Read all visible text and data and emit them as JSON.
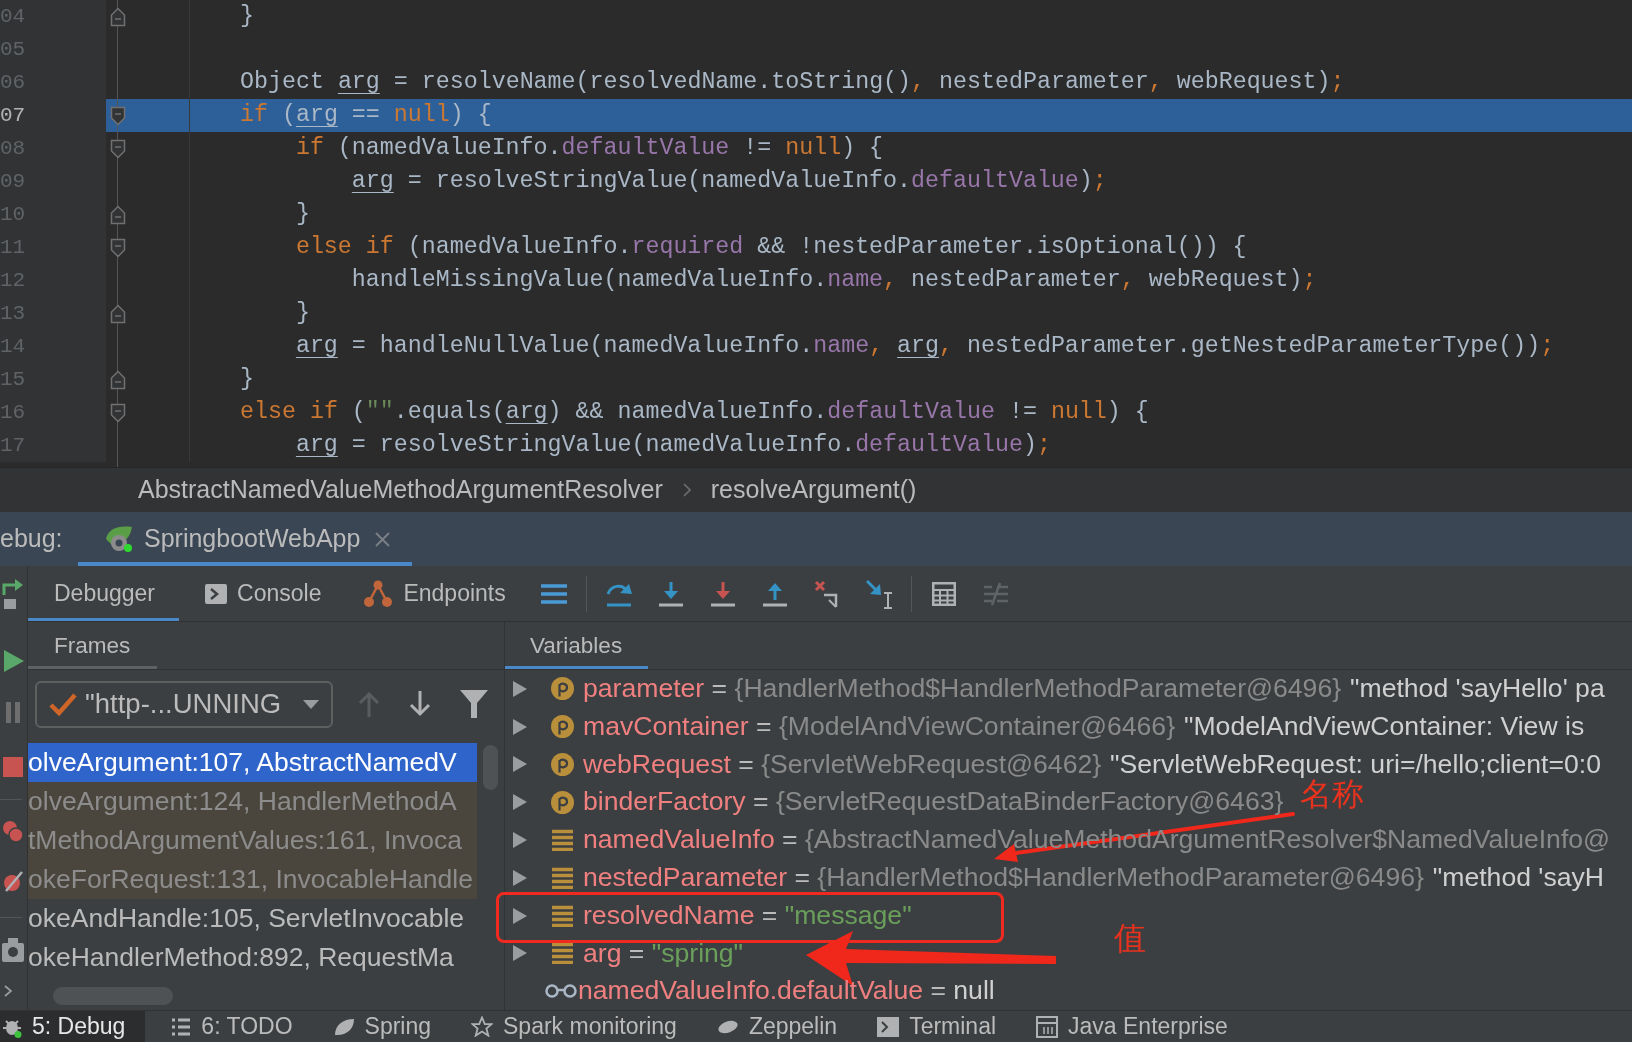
{
  "editor": {
    "lines": [
      {
        "number": "04",
        "current": false,
        "block_end": true,
        "tokens": [
          {
            "text": "}",
            "kind": "plain"
          }
        ]
      },
      {
        "number": "05",
        "current": false
      },
      {
        "number": "06",
        "current": false,
        "tokens": [
          {
            "text": "Object ",
            "kind": "plain"
          },
          {
            "text": "arg",
            "kind": "var"
          },
          {
            "text": " = resolveName(resolvedName.toString()",
            "kind": "plain"
          },
          {
            "text": ",",
            "kind": "punct"
          },
          {
            "text": " nestedParameter",
            "kind": "plain"
          },
          {
            "text": ",",
            "kind": "punct"
          },
          {
            "text": " webRequest)",
            "kind": "plain"
          },
          {
            "text": ";",
            "kind": "punct"
          }
        ]
      },
      {
        "number": "07",
        "current": true,
        "block_start": true,
        "tokens": [
          {
            "text": "if",
            "kind": "keyword"
          },
          {
            "text": " (",
            "kind": "plain"
          },
          {
            "text": "arg",
            "kind": "var"
          },
          {
            "text": " == ",
            "kind": "plain"
          },
          {
            "text": "null",
            "kind": "keyword"
          },
          {
            "text": ") {",
            "kind": "plain"
          }
        ],
        "children": [
          {
            "number": "08",
            "current": false,
            "block_start": true,
            "tokens": [
              {
                "text": "if",
                "kind": "keyword"
              },
              {
                "text": " (namedValueInfo.",
                "kind": "plain"
              },
              {
                "text": "defaultValue",
                "kind": "field"
              },
              {
                "text": " != ",
                "kind": "plain"
              },
              {
                "text": "null",
                "kind": "keyword"
              },
              {
                "text": ") {",
                "kind": "plain"
              }
            ],
            "children": [
              {
                "number": "09",
                "current": false,
                "tokens": [
                  {
                    "text": "arg",
                    "kind": "var"
                  },
                  {
                    "text": " = resolveStringValue(namedValueInfo.",
                    "kind": "plain"
                  },
                  {
                    "text": "defaultValue",
                    "kind": "field"
                  },
                  {
                    "text": ")",
                    "kind": "plain"
                  },
                  {
                    "text": ";",
                    "kind": "punct"
                  }
                ]
              }
            ]
          },
          {
            "number": "10",
            "current": false,
            "block_end": true,
            "tokens": [
              {
                "text": "}",
                "kind": "plain"
              }
            ]
          },
          {
            "number": "11",
            "current": false,
            "block_start": true,
            "tokens": [
              {
                "text": "else if",
                "kind": "keyword"
              },
              {
                "text": " (namedValueInfo.",
                "kind": "plain"
              },
              {
                "text": "required",
                "kind": "field"
              },
              {
                "text": " && !nestedParameter.isOptional()) {",
                "kind": "plain"
              }
            ],
            "children": [
              {
                "number": "12",
                "current": false,
                "tokens": [
                  {
                    "text": "handleMissingValue(namedValueInfo.",
                    "kind": "plain"
                  },
                  {
                    "text": "name",
                    "kind": "field"
                  },
                  {
                    "text": ",",
                    "kind": "punct"
                  },
                  {
                    "text": " nestedParameter",
                    "kind": "plain"
                  },
                  {
                    "text": ",",
                    "kind": "punct"
                  },
                  {
                    "text": " webRequest)",
                    "kind": "plain"
                  },
                  {
                    "text": ";",
                    "kind": "punct"
                  }
                ]
              }
            ]
          },
          {
            "number": "13",
            "current": false,
            "block_end": true,
            "tokens": [
              {
                "text": "}",
                "kind": "plain"
              }
            ]
          },
          {
            "number": "14",
            "current": false,
            "tokens": [
              {
                "text": "arg",
                "kind": "var"
              },
              {
                "text": " = handleNullValue(namedValueInfo.",
                "kind": "plain"
              },
              {
                "text": "name",
                "kind": "field"
              },
              {
                "text": ", ",
                "kind": "punct"
              },
              {
                "text": "arg",
                "kind": "var"
              },
              {
                "text": ",",
                "kind": "punct"
              },
              {
                "text": " nestedParameter.getNestedParameterType())",
                "kind": "plain"
              },
              {
                "text": ";",
                "kind": "punct"
              }
            ]
          }
        ]
      },
      {
        "number": "15",
        "current": false,
        "block_end": true,
        "tokens": [
          {
            "text": "}",
            "kind": "plain"
          }
        ]
      },
      {
        "number": "16",
        "current": false,
        "block_start": true,
        "tokens": [
          {
            "text": "else if",
            "kind": "keyword"
          },
          {
            "text": " (",
            "kind": "plain"
          },
          {
            "text": "\"\"",
            "kind": "string"
          },
          {
            "text": ".equals(",
            "kind": "plain"
          },
          {
            "text": "arg",
            "kind": "var"
          },
          {
            "text": ") && namedValueInfo.",
            "kind": "plain"
          },
          {
            "text": "defaultValue",
            "kind": "field"
          },
          {
            "text": " != ",
            "kind": "plain"
          },
          {
            "text": "null",
            "kind": "keyword"
          },
          {
            "text": ") {",
            "kind": "plain"
          }
        ],
        "children": [
          {
            "number": "17",
            "current": false,
            "tokens": [
              {
                "text": "arg",
                "kind": "var"
              },
              {
                "text": " = resolveStringValue(namedValueInfo.",
                "kind": "plain"
              },
              {
                "text": "defaultValue",
                "kind": "field"
              },
              {
                "text": ")",
                "kind": "plain"
              },
              {
                "text": ";",
                "kind": "punct"
              }
            ]
          }
        ]
      }
    ]
  },
  "breadcrumb": {
    "items": [
      {
        "label": "AbstractNamedValueMethodArgumentResolver"
      },
      {
        "label": "resolveArgument()"
      }
    ]
  },
  "debug_window": {
    "title": "ebug:",
    "tabs": [
      {
        "label": "SpringbootWebApp",
        "selected": true
      }
    ]
  },
  "debugger_toolbar": {
    "tabs": [
      {
        "kind": "debugger",
        "label": "Debugger",
        "selected": true
      },
      {
        "kind": "console",
        "label": "Console",
        "selected": false
      },
      {
        "kind": "endpoints",
        "label": "Endpoints",
        "selected": false
      }
    ],
    "actions": [
      {
        "kind": "frames_menu",
        "disabled": false
      },
      {
        "kind": "step_over",
        "disabled": false
      },
      {
        "kind": "step_into",
        "disabled": false
      },
      {
        "kind": "force_step_into",
        "disabled": false
      },
      {
        "kind": "step_out",
        "disabled": false
      },
      {
        "kind": "drop_frame",
        "disabled": false
      },
      {
        "kind": "run_to_cursor",
        "disabled": false
      },
      {
        "kind": "evaluate",
        "disabled": false
      },
      {
        "kind": "trace",
        "disabled": true
      }
    ]
  },
  "frames_panel": {
    "tab": {
      "label": "Frames",
      "selected": true,
      "focused": false
    },
    "thread": {
      "value": "\"http-...UNNING"
    },
    "nav": [
      {
        "kind": "up",
        "disabled": true
      },
      {
        "kind": "down",
        "disabled": false
      },
      {
        "kind": "filter",
        "disabled": false
      }
    ],
    "frames": [
      {
        "label": "olveArgument:107, AbstractNamedV",
        "selected": true
      },
      {
        "label": "olveArgument:124, HandlerMethodA",
        "selected": false,
        "library": true
      },
      {
        "label": "tMethodArgumentValues:161, Invoca",
        "selected": false,
        "library": true
      },
      {
        "label": "okeForRequest:131, InvocableHandle",
        "selected": false,
        "library": true
      },
      {
        "label": "okeAndHandle:105, ServletInvocable",
        "selected": false,
        "library": false
      },
      {
        "label": "okeHandlerMethod:892, RequestMa",
        "selected": false,
        "library": false
      }
    ]
  },
  "variables_panel": {
    "tab": {
      "label": "Variables",
      "selected": true,
      "focused": true
    },
    "variables": [
      {
        "kind": "parameter",
        "expandable": true,
        "name": "parameter",
        "operator": "=",
        "type": "{HandlerMethod$HandlerMethodParameter@6496}",
        "value": "\"method 'sayHello' pa",
        "string_literal": false
      },
      {
        "kind": "parameter",
        "expandable": true,
        "name": "mavContainer",
        "operator": "=",
        "type": "{ModelAndViewContainer@6466}",
        "value": "\"ModelAndViewContainer: View is",
        "string_literal": false
      },
      {
        "kind": "parameter",
        "expandable": true,
        "name": "webRequest",
        "operator": "=",
        "type": "{ServletWebRequest@6462}",
        "value": "\"ServletWebRequest: uri=/hello;client=0:0",
        "string_literal": false
      },
      {
        "kind": "parameter",
        "expandable": true,
        "name": "binderFactory",
        "operator": "=",
        "type": "{ServletRequestDataBinderFactory@6463}"
      },
      {
        "kind": "local",
        "expandable": true,
        "name": "namedValueInfo",
        "operator": "=",
        "type": "{AbstractNamedValueMethodArgumentResolver$NamedValueInfo@"
      },
      {
        "kind": "local",
        "expandable": true,
        "name": "nestedParameter",
        "operator": "=",
        "type": "{HandlerMethod$HandlerMethodParameter@6496}",
        "value": "\"method 'sayH",
        "string_literal": false
      },
      {
        "kind": "local",
        "expandable": true,
        "name": "resolvedName",
        "operator": "=",
        "value": "\"message\"",
        "string_literal": true
      },
      {
        "kind": "local",
        "expandable": true,
        "name": "arg",
        "operator": "=",
        "value": "\"spring\"",
        "string_literal": true
      },
      {
        "kind": "watch",
        "expandable": false,
        "name": "namedValueInfo.defaultValue",
        "operator": "=",
        "value": "null",
        "string_literal": false
      }
    ]
  },
  "tool_windows": [
    {
      "kind": "debug",
      "label": "5: Debug",
      "selected": true
    },
    {
      "kind": "todo",
      "label": "6: TODO",
      "selected": false
    },
    {
      "kind": "spring",
      "label": "Spring",
      "selected": false
    },
    {
      "kind": "spark",
      "label": "Spark monitoring",
      "selected": false
    },
    {
      "kind": "zeppelin",
      "label": "Zeppelin",
      "selected": false
    },
    {
      "kind": "terminal",
      "label": "Terminal",
      "selected": false
    },
    {
      "kind": "java_enterprise",
      "label": "Java Enterprise",
      "selected": false
    }
  ],
  "annotations": {
    "name_label": "名称",
    "value_label": "值"
  }
}
